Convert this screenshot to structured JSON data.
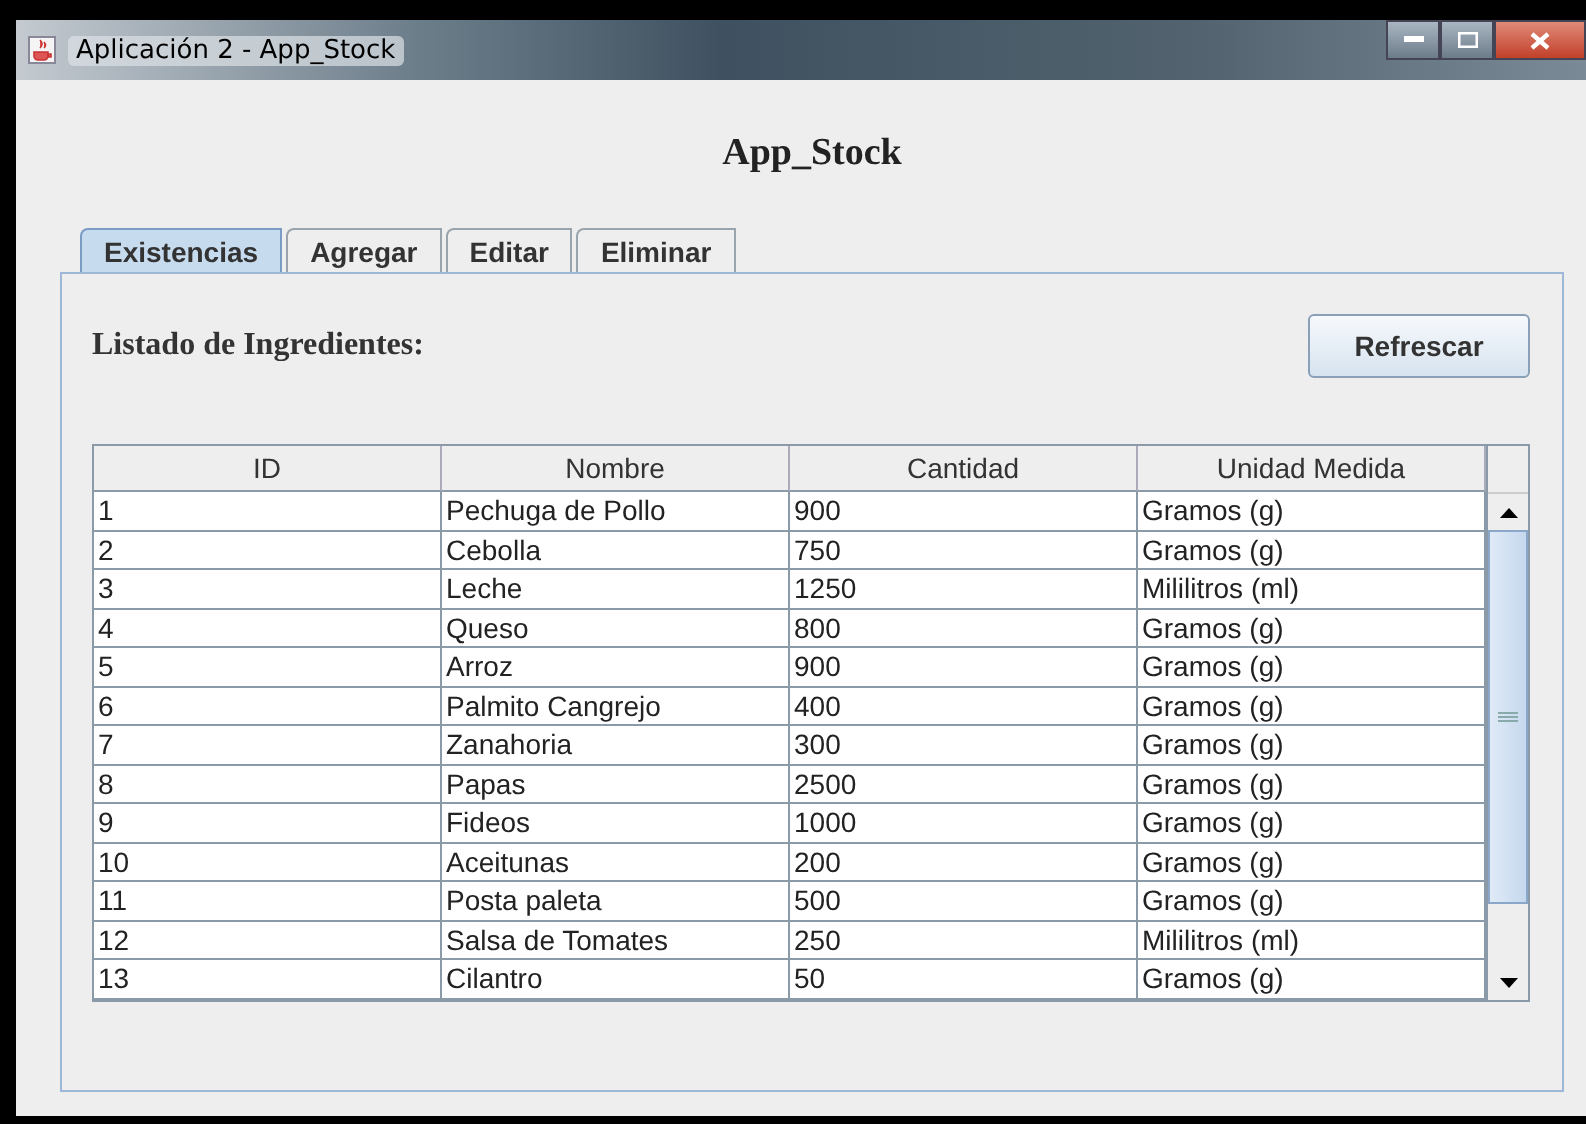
{
  "window": {
    "title": "Aplicación 2 - App_Stock"
  },
  "heading": "App_Stock",
  "tabs": [
    {
      "label": "Existencias",
      "selected": true
    },
    {
      "label": "Agregar",
      "selected": false
    },
    {
      "label": "Editar",
      "selected": false
    },
    {
      "label": "Eliminar",
      "selected": false
    }
  ],
  "panel": {
    "title": "Listado de Ingredientes:",
    "refresh_button": "Refrescar"
  },
  "table": {
    "columns": [
      "ID",
      "Nombre",
      "Cantidad",
      "Unidad Medida"
    ],
    "rows": [
      [
        "1",
        "Pechuga de Pollo",
        "900",
        "Gramos (g)"
      ],
      [
        "2",
        "Cebolla",
        "750",
        "Gramos (g)"
      ],
      [
        "3",
        "Leche",
        "1250",
        "Mililitros (ml)"
      ],
      [
        "4",
        "Queso",
        "800",
        "Gramos (g)"
      ],
      [
        "5",
        "Arroz",
        "900",
        "Gramos (g)"
      ],
      [
        "6",
        "Palmito Cangrejo",
        "400",
        "Gramos (g)"
      ],
      [
        "7",
        "Zanahoria",
        "300",
        "Gramos (g)"
      ],
      [
        "8",
        "Papas",
        "2500",
        "Gramos (g)"
      ],
      [
        "9",
        "Fideos",
        "1000",
        "Gramos (g)"
      ],
      [
        "10",
        "Aceitunas",
        "200",
        "Gramos (g)"
      ],
      [
        "11",
        "Posta paleta",
        "500",
        "Gramos (g)"
      ],
      [
        "12",
        "Salsa de Tomates",
        "250",
        "Mililitros (ml)"
      ],
      [
        "13",
        "Cilantro",
        "50",
        "Gramos (g)"
      ]
    ]
  }
}
